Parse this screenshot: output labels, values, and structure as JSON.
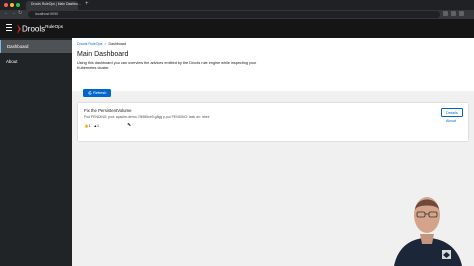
{
  "browser": {
    "tab_title": "Drools RuleOps | Main Dashbo…",
    "tab_close": "×",
    "new_tab": "+",
    "url": "localhost:9090",
    "nav_back": "←",
    "nav_forward": "→",
    "nav_reload": "↻"
  },
  "header": {
    "brand": "Drools",
    "brand_suffix": "RuleOps"
  },
  "sidebar": {
    "items": [
      {
        "label": "Dashboard",
        "active": true
      },
      {
        "label": "About",
        "active": false
      }
    ]
  },
  "main": {
    "breadcrumb": [
      "Drools RuleOps",
      "Dashboard"
    ],
    "breadcrumb_sep": ">",
    "title": "Main Dashboard",
    "description": "Using this dashboard you can overview the advices emitted by the Drools rule engine while inspecting your Kubernetes cluster.",
    "refresh_label": "Refresh"
  },
  "advice_card": {
    "title": "Fix the PersistentVolume",
    "subtitle": "Pod PENDING: pod: apache-demo-7f4986ce9-g8gg p-poi PENDING: task an: nfore",
    "details_label": "Details",
    "about_label": "About",
    "likes": "1",
    "warnings": "1"
  },
  "colors": {
    "accent": "#0066cc",
    "header_bg": "#151515",
    "sidebar_bg": "#212427",
    "logo_red": "#e02b20"
  }
}
